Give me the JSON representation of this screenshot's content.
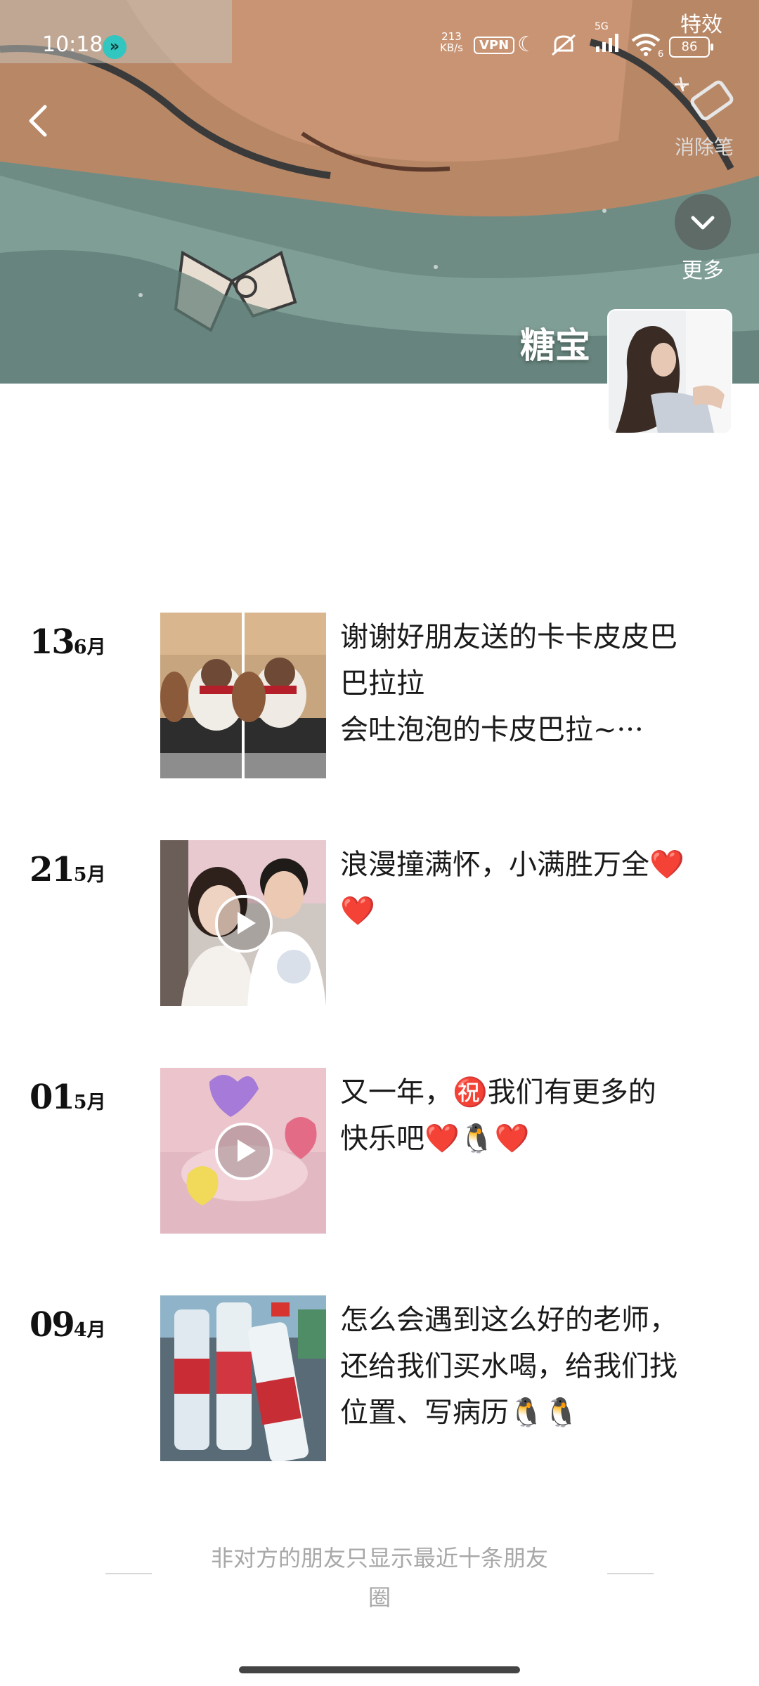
{
  "status_bar": {
    "time": "10:18",
    "net_speed_value": "213",
    "net_speed_unit": "KB/s",
    "vpn": "VPN",
    "signal_label": "5G",
    "wifi_label": "6",
    "battery": "86"
  },
  "header": {
    "fx_label": "特效",
    "eraser_label": "消除笔",
    "more_label": "更多",
    "nickname": "糖宝"
  },
  "posts": [
    {
      "day": "13",
      "month": "6月",
      "lines": [
        "谢谢好朋友送的卡卡皮皮巴",
        "巴拉拉",
        "会吐泡泡的卡皮巴拉~···"
      ]
    },
    {
      "day": "21",
      "month": "5月",
      "lines": [
        "浪漫撞满怀，小满胜万全❤️",
        "❤️"
      ]
    },
    {
      "day": "01",
      "month": "5月",
      "lines": [
        "又一年，㊗️我们有更多的",
        "快乐吧❤️🐧❤️"
      ]
    },
    {
      "day": "09",
      "month": "4月",
      "lines": [
        "怎么会遇到这么好的老师，",
        "还给我们买水喝，给我们找",
        "位置、写病历🐧🐧"
      ]
    }
  ],
  "footer": {
    "note_line1": "非对方的朋友只显示最近十条朋友",
    "note_line2": "圈"
  },
  "colors": {
    "background": "#ffffff",
    "caption_text": "#1a1a1a",
    "footer_text": "#a8a8a8"
  }
}
